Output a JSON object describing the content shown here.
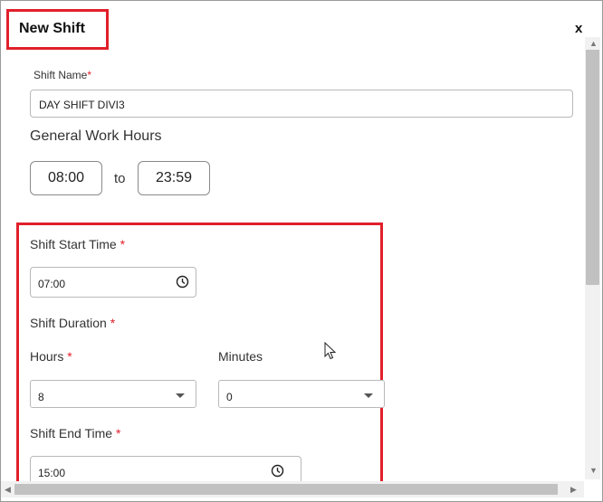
{
  "dialog": {
    "title": "New Shift",
    "close_label": "x"
  },
  "shift_name": {
    "label": "Shift Name",
    "required_mark": "*",
    "value": "DAY SHIFT DIVI3"
  },
  "general_hours": {
    "heading": "General Work Hours",
    "from": "08:00",
    "separator": "to",
    "to": "23:59"
  },
  "shift_start": {
    "label": "Shift Start Time",
    "required_mark": "*",
    "value": "07:00",
    "icon": "clock-icon"
  },
  "shift_duration": {
    "label": "Shift Duration",
    "required_mark": "*",
    "hours": {
      "label": "Hours",
      "required_mark": "*",
      "value": "8"
    },
    "minutes": {
      "label": "Minutes",
      "value": "0"
    }
  },
  "shift_end": {
    "label": "Shift End Time",
    "required_mark": "*",
    "value": "15:00",
    "icon": "clock-icon"
  },
  "colors": {
    "highlight": "#e0202b",
    "required": "#e0202b"
  }
}
